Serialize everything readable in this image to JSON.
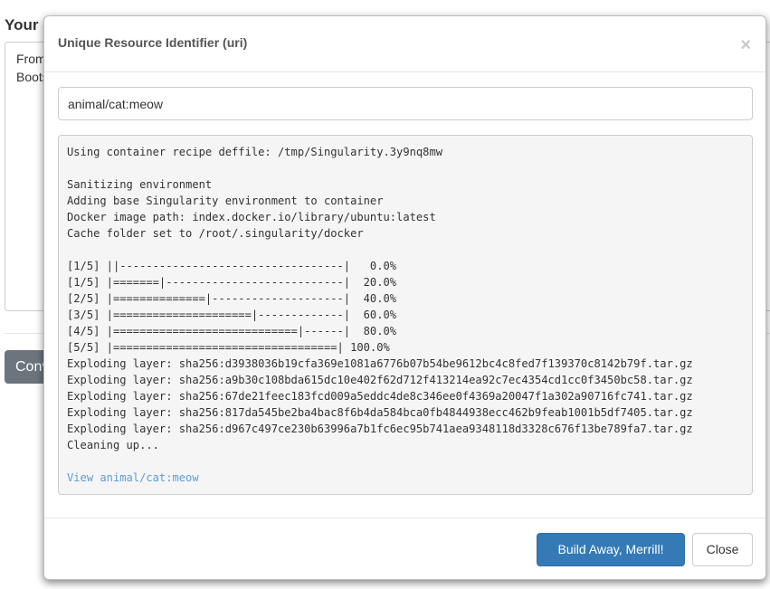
{
  "background": {
    "title": "Your S",
    "textarea_lines": [
      "From",
      "Boots"
    ],
    "button_label": "Conv"
  },
  "modal": {
    "title": "Unique Resource Identifier (uri)",
    "close_glyph": "×",
    "uri_value": "animal/cat:meow",
    "log_lines": [
      "Using container recipe deffile: /tmp/Singularity.3y9nq8mw",
      "",
      "Sanitizing environment",
      "Adding base Singularity environment to container",
      "Docker image path: index.docker.io/library/ubuntu:latest",
      "Cache folder set to /root/.singularity/docker",
      "",
      "[1/5] ||----------------------------------|   0.0%",
      "[1/5] |=======|---------------------------|  20.0%",
      "[2/5] |==============|--------------------|  40.0%",
      "[3/5] |=====================|-------------|  60.0%",
      "[4/5] |============================|------|  80.0%",
      "[5/5] |==================================| 100.0%",
      "Exploding layer: sha256:d3938036b19cfa369e1081a6776b07b54be9612bc4c8fed7f139370c8142b79f.tar.gz",
      "Exploding layer: sha256:a9b30c108bda615dc10e402f62d712f413214ea92c7ec4354cd1cc0f3450bc58.tar.gz",
      "Exploding layer: sha256:67de21feec183fcd009a5eddc4de8c346ee0f4369a20047f1a302a90716fc741.tar.gz",
      "Exploding layer: sha256:817da545be2ba4bac8f6b4da584bca0fb4844938ecc462b9feab1001b5df7405.tar.gz",
      "Exploding layer: sha256:d967c497ce230b63996a7b1fc6ec95b741aea9348118d3328c676f13be789fa7.tar.gz",
      "Cleaning up...",
      ""
    ],
    "view_link": "View animal/cat:meow",
    "build_button": "Build Away, Merrill!",
    "close_button": "Close"
  },
  "colors": {
    "primary": "#337ab7",
    "link": "#5d9ed2",
    "secondary": "#6c757d"
  }
}
